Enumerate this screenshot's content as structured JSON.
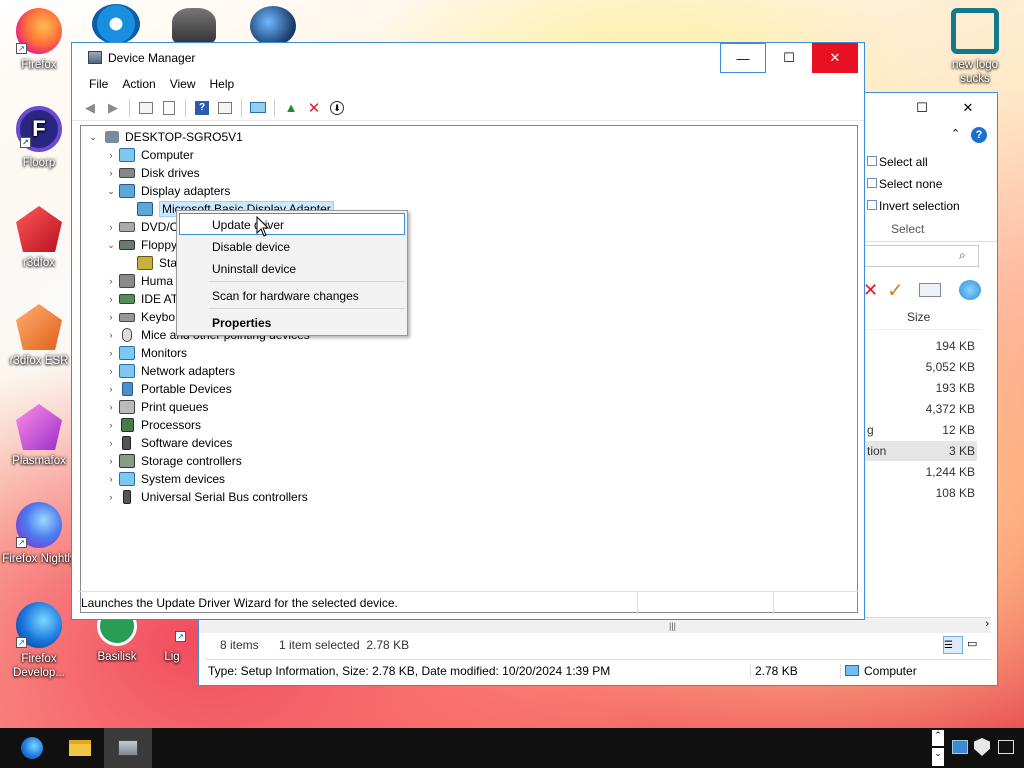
{
  "desktop": {
    "icons": [
      {
        "label": "Firefox"
      },
      {
        "label": "Floorp"
      },
      {
        "label": "r3dfox"
      },
      {
        "label": "r3dfox ESR"
      },
      {
        "label": "Plasmafox"
      },
      {
        "label": "Firefox Nightly"
      },
      {
        "label": "Firefox Develop..."
      },
      {
        "label": "Basilisk"
      },
      {
        "label": "Lig"
      },
      {
        "label": "new logo sucks"
      }
    ]
  },
  "device_manager": {
    "title": "Device Manager",
    "menu": [
      "File",
      "Action",
      "View",
      "Help"
    ],
    "tree": {
      "root": "DESKTOP-SGRO5V1",
      "items": [
        {
          "label": "Computer"
        },
        {
          "label": "Disk drives"
        },
        {
          "label": "Display adapters"
        },
        {
          "label": "Microsoft Basic Display Adapter"
        },
        {
          "label": "DVD/C"
        },
        {
          "label": "Floppy"
        },
        {
          "label": "Sta"
        },
        {
          "label": "Huma"
        },
        {
          "label": "IDE AT"
        },
        {
          "label": "Keybo"
        },
        {
          "label": "Mice and other pointing devices"
        },
        {
          "label": "Monitors"
        },
        {
          "label": "Network adapters"
        },
        {
          "label": "Portable Devices"
        },
        {
          "label": "Print queues"
        },
        {
          "label": "Processors"
        },
        {
          "label": "Software devices"
        },
        {
          "label": "Storage controllers"
        },
        {
          "label": "System devices"
        },
        {
          "label": "Universal Serial Bus controllers"
        }
      ]
    },
    "context_menu": {
      "update_driver": "Update driver",
      "disable_device": "Disable device",
      "uninstall_device": "Uninstall device",
      "scan": "Scan for hardware changes",
      "properties": "Properties"
    },
    "status_text": "Launches the Update Driver Wizard for the selected device."
  },
  "explorer": {
    "ribbon": {
      "select_all": "Select all",
      "select_none": "Select none",
      "invert_selection": "Invert selection",
      "group_label": "Select"
    },
    "column_size": "Size",
    "sizes": [
      "194 KB",
      "5,052 KB",
      "193 KB",
      "4,372 KB",
      "12 KB",
      "3 KB",
      "1,244 KB",
      "108 KB"
    ],
    "name_fragments": {
      "row5": "g",
      "row6": "tion"
    },
    "status": {
      "items": "8 items",
      "selected": "1 item selected  2.78 KB"
    },
    "details": {
      "type_line": "Type: Setup Information, Size: 2.78 KB, Date modified: 10/20/2024 1:39 PM",
      "size": "2.78 KB",
      "location": "Computer"
    }
  },
  "colors": {
    "accent": "#3c8ed8",
    "menu_highlight": "#cce8ff",
    "taskbar": "#101010"
  }
}
